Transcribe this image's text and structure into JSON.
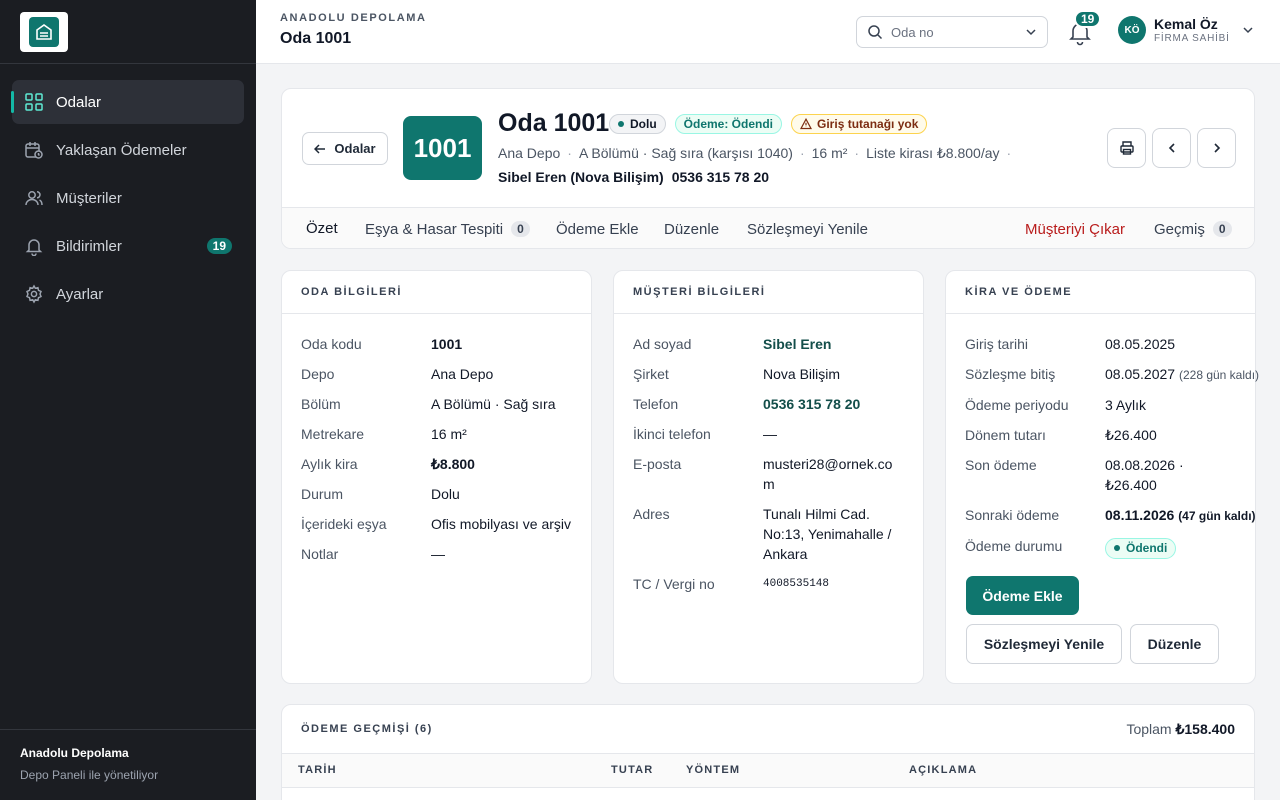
{
  "sidebar": {
    "items": [
      {
        "label": "Odalar"
      },
      {
        "label": "Yaklaşan Ödemeler"
      },
      {
        "label": "Müşteriler"
      },
      {
        "label": "Bildirimler",
        "badge": "19"
      },
      {
        "label": "Ayarlar"
      }
    ],
    "footer_title": "Anadolu Depolama",
    "footer_sub": "Depo Paneli ile yönetiliyor"
  },
  "topbar": {
    "brand": "ANADOLU DEPOLAMA",
    "title": "Oda 1001",
    "search_placeholder": "Oda no",
    "notif_count": "19",
    "user_initials": "KÖ",
    "user_name": "Kemal Öz",
    "user_role": "FİRMA SAHİBİ"
  },
  "header": {
    "back_label": "Odalar",
    "room_code": "1001",
    "room_title": "Oda 1001",
    "pills": {
      "status": "Dolu",
      "payment": "Ödeme: Ödendi",
      "warning": "Giriş tutanağı yok"
    },
    "meta": [
      "Ana Depo",
      "A Bölümü · Sağ sıra (karşısı 1040)",
      "16 m²",
      "Liste kirası ₺8.800/ay"
    ],
    "customer": "Sibel Eren (Nova Bilişim)",
    "phone": "0536 315 78 20"
  },
  "tabs": [
    {
      "label": "Özet"
    },
    {
      "label": "Eşya & Hasar Tespiti",
      "count": "0"
    },
    {
      "label": "Ödeme Ekle"
    },
    {
      "label": "Düzenle"
    },
    {
      "label": "Sözleşmeyi Yenile"
    },
    {
      "label": "Müşteriyi Çıkar"
    },
    {
      "label": "Geçmiş",
      "count": "0"
    }
  ],
  "room_info": {
    "title": "ODA BİLGİLERİ",
    "rows": [
      {
        "k": "Oda kodu",
        "v": "1001"
      },
      {
        "k": "Depo",
        "v": "Ana Depo"
      },
      {
        "k": "Bölüm",
        "v": "A Bölümü · Sağ sıra"
      },
      {
        "k": "Metrekare",
        "v": "16 m²"
      },
      {
        "k": "Aylık kira",
        "v": "₺8.800"
      },
      {
        "k": "Durum",
        "v": "Dolu"
      },
      {
        "k": "İçerideki eşya",
        "v": "Ofis mobilyası ve arşiv"
      },
      {
        "k": "Notlar",
        "v": "—"
      }
    ]
  },
  "customer_info": {
    "title": "MÜŞTERİ BİLGİLERİ",
    "rows": [
      {
        "k": "Ad soyad",
        "v": "Sibel Eren"
      },
      {
        "k": "Şirket",
        "v": "Nova Bilişim"
      },
      {
        "k": "Telefon",
        "v": "0536 315 78 20"
      },
      {
        "k": "İkinci telefon",
        "v": "—"
      },
      {
        "k": "E-posta",
        "v": "musteri28@ornek.com"
      },
      {
        "k": "Adres",
        "v": "Tunalı Hilmi Cad. No:13, Yenimahalle / Ankara"
      },
      {
        "k": "TC / Vergi no",
        "v": "4008535148"
      }
    ]
  },
  "rent": {
    "title": "KİRA VE ÖDEME",
    "rows": [
      {
        "k": "Giriş tarihi",
        "v": "08.05.2025"
      },
      {
        "k": "Sözleşme bitiş",
        "v": "08.05.2027",
        "note": "(228 gün kaldı)"
      },
      {
        "k": "Ödeme periyodu",
        "v": "3 Aylık"
      },
      {
        "k": "Dönem tutarı",
        "v": "₺26.400"
      },
      {
        "k": "Son ödeme",
        "v": "08.08.2026 · ₺26.400"
      },
      {
        "k": "Sonraki ödeme",
        "v": "08.11.2026",
        "note": "(47 gün kaldı)"
      },
      {
        "k": "Ödeme durumu",
        "v": "Ödendi"
      }
    ],
    "pay_button": "Ödeme Ekle",
    "renew_button": "Sözleşmeyi Yenile",
    "edit_button": "Düzenle"
  },
  "history": {
    "title": "ÖDEME GEÇMİŞİ (6)",
    "total_label": "Toplam",
    "total_value": "₺158.400",
    "columns": [
      "TARİH",
      "TUTAR",
      "YÖNTEM",
      "AÇIKLAMA"
    ]
  },
  "colors": {
    "accent": "#0f766e",
    "sidebar": "#1b1d22",
    "danger": "#b91c1c"
  }
}
